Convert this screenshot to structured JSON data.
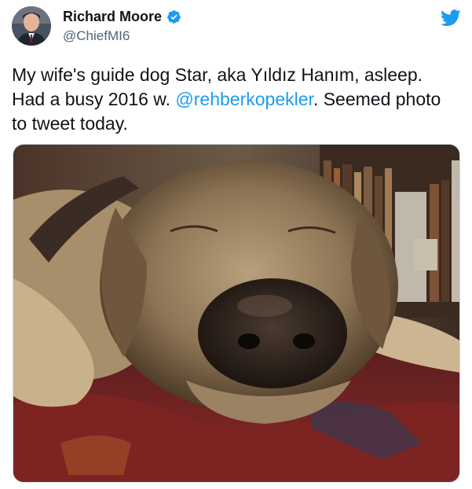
{
  "tweet": {
    "author_name": "Richard Moore",
    "author_handle": "@ChiefMI6",
    "verified": true,
    "text_part1": "My wife's guide dog Star, aka Yıldız Hanım, asleep. Had a busy 2016 w. ",
    "mention": "@rehberkopekler",
    "text_part2": ". Seemed photo to tweet today."
  },
  "icons": {
    "verified": "verified-badge-icon",
    "brand": "twitter-bird-icon"
  },
  "colors": {
    "link": "#1d9bf0",
    "verified": "#1d9bf0",
    "secondary_text": "#536471"
  }
}
